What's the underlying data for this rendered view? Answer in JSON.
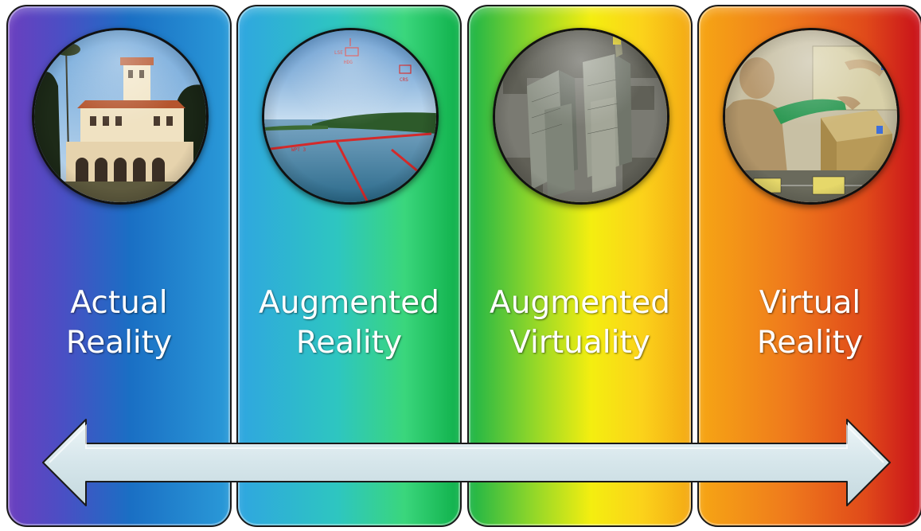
{
  "panels": [
    {
      "label_line1": "Actual",
      "label_line2": "Reality",
      "picture": "building-photo"
    },
    {
      "label_line1": "Augmented",
      "label_line2": "Reality",
      "picture": "sea-hud-photo"
    },
    {
      "label_line1": "Augmented",
      "label_line2": "Virtuality",
      "picture": "city-render"
    },
    {
      "label_line1": "Virtual",
      "label_line2": "Reality",
      "picture": "virtual-arm-render"
    }
  ],
  "colors": {
    "panel1": "#2a9ad8",
    "panel2": "#0fb04a",
    "panel3": "#f4ee10",
    "panel4": "#c8101a",
    "arrow_fill": "#d9e8ed"
  },
  "arrow": {
    "type": "double-headed",
    "icon": "double-arrow-icon"
  }
}
